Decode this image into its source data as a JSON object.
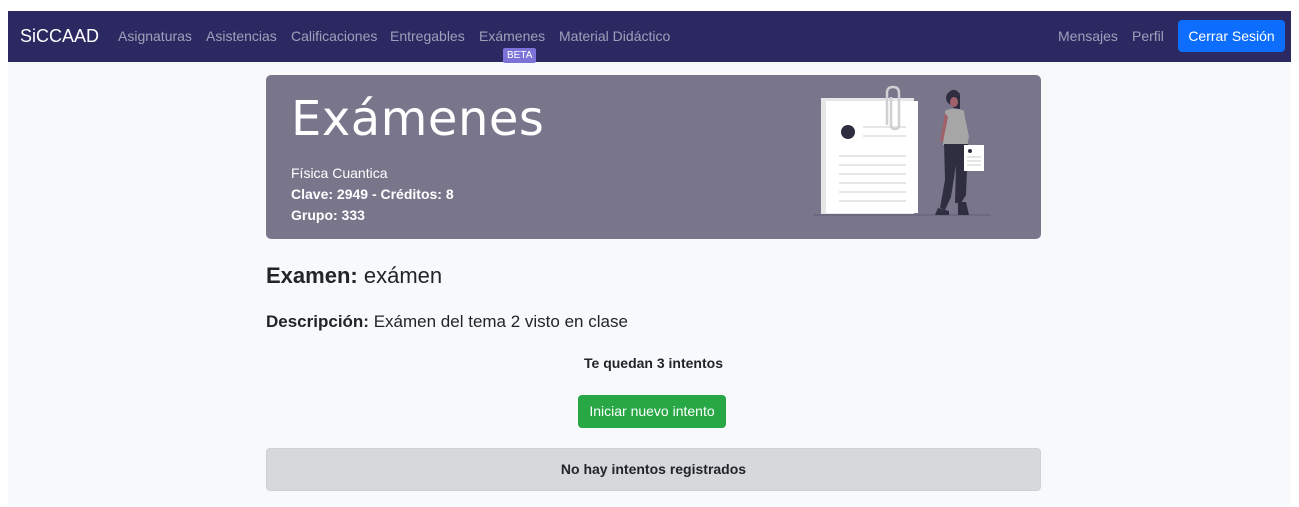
{
  "navbar": {
    "brand": "SiCCAAD",
    "links": [
      "Asignaturas",
      "Asistencias",
      "Calificaciones",
      "Entregables",
      "Exámenes",
      "Material Didáctico"
    ],
    "beta_badge": "BETA",
    "right_links": [
      "Mensajes",
      "Perfil"
    ],
    "logout_label": "Cerrar Sesión"
  },
  "header": {
    "title": "Exámenes",
    "course_name": "Física Cuantica",
    "clave_line": "Clave: 2949 - Créditos: 8",
    "grupo_line": "Grupo: 333"
  },
  "exam": {
    "title_label": "Examen:",
    "title_value": "exámen",
    "desc_label": "Descripción:",
    "desc_value": "Exámen del tema 2 visto en clase",
    "attempts_left": "Te quedan 3 intentos",
    "new_attempt_label": "Iniciar nuevo intento",
    "no_attempts": "No hay intentos registrados"
  },
  "colors": {
    "navbar_bg": "#2b2862",
    "header_bg": "#79768c",
    "primary": "#0d6efd",
    "success": "#28a745",
    "beta": "#7c73d8"
  }
}
